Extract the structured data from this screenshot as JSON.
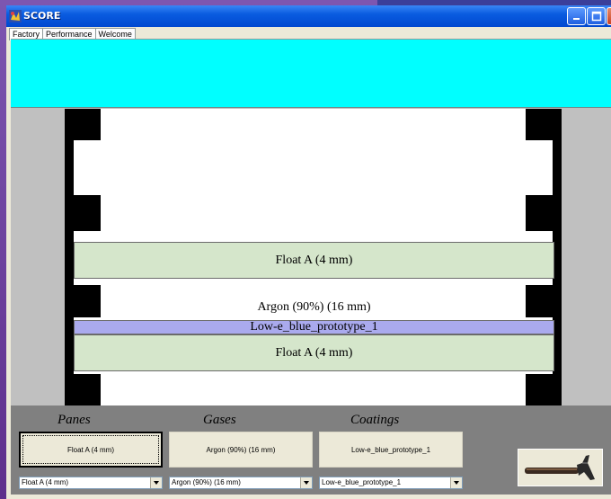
{
  "window": {
    "title": "SCORE"
  },
  "tabs": [
    {
      "label": "Factory",
      "active": true
    },
    {
      "label": "Performance",
      "active": false
    },
    {
      "label": "Welcome",
      "active": false
    }
  ],
  "colors": {
    "banner": "#00ffff",
    "pane_fill": "#d5e6cb",
    "coating_fill": "#aaaaee",
    "frame": "#000000"
  },
  "glazing": {
    "layers": [
      {
        "kind": "pane",
        "label": "Float A (4 mm)"
      },
      {
        "kind": "gas",
        "label": "Argon (90%) (16 mm)"
      },
      {
        "kind": "coating",
        "label": "Low-e_blue_prototype_1"
      },
      {
        "kind": "pane",
        "label": "Float A (4 mm)"
      }
    ]
  },
  "controls": {
    "panes": {
      "heading": "Panes",
      "button": "Float A (4 mm)",
      "selected": "Float A (4 mm)"
    },
    "gases": {
      "heading": "Gases",
      "button": "Argon (90%) (16 mm)",
      "selected": "Argon (90%) (16 mm)"
    },
    "coatings": {
      "heading": "Coatings",
      "button": "Low-e_blue_prototype_1",
      "selected": "Low-e_blue_prototype_1"
    },
    "build_icon": "hammer-icon"
  }
}
